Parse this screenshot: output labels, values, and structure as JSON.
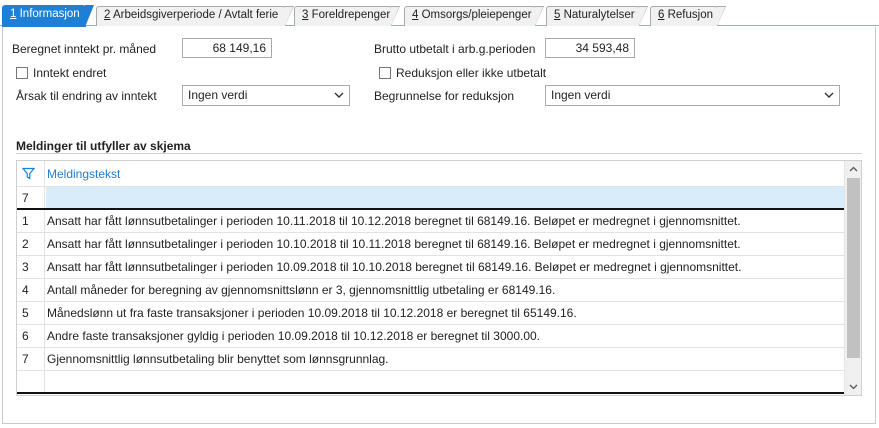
{
  "tabs": [
    {
      "key": "1",
      "label": " Informasjon",
      "active": true
    },
    {
      "key": "2",
      "label": " Arbeidsgiverperiode / Avtalt ferie",
      "active": false
    },
    {
      "key": "3",
      "label": " Foreldrepenger",
      "active": false
    },
    {
      "key": "4",
      "label": " Omsorgs/pleiepenger",
      "active": false
    },
    {
      "key": "5",
      "label": " Naturalytelser",
      "active": false
    },
    {
      "key": "6",
      "label": " Refusjon",
      "active": false
    }
  ],
  "form": {
    "income_label": "Beregnet inntekt pr. måned",
    "income_value": "68 149,16",
    "gross_label": "Brutto utbetalt i arb.g.perioden",
    "gross_value": "34 593,48",
    "income_changed_label": "Inntekt endret",
    "reduction_label": "Reduksjon eller ikke utbetalt",
    "reason_label": "Årsak til endring av inntekt",
    "reason_value": "Ingen verdi",
    "justification_label": "Begrunnelse for reduksjon",
    "justification_value": "Ingen verdi"
  },
  "messages": {
    "title": "Meldinger til utfyller av skjema",
    "column_header": "Meldingstekst",
    "filter_value": "7",
    "rows": [
      {
        "idx": "1",
        "text": "Ansatt har fått lønnsutbetalinger i perioden 10.11.2018 til 10.12.2018 beregnet til 68149.16. Beløpet er medregnet i gjennomsnittet."
      },
      {
        "idx": "2",
        "text": "Ansatt har fått lønnsutbetalinger i perioden 10.10.2018 til 10.11.2018 beregnet til 68149.16. Beløpet er medregnet i gjennomsnittet."
      },
      {
        "idx": "3",
        "text": "Ansatt har fått lønnsutbetalinger i perioden 10.09.2018 til 10.10.2018 beregnet til 68149.16. Beløpet er medregnet i gjennomsnittet."
      },
      {
        "idx": "4",
        "text": "Antall måneder for beregning av gjennomsnittslønn er 3, gjennomsnittlig utbetaling er 68149.16."
      },
      {
        "idx": "5",
        "text": "Månedslønn ut fra faste transaksjoner i perioden 10.09.2018 til 10.12.2018 er beregnet til 65149.16."
      },
      {
        "idx": "6",
        "text": "Andre faste transaksjoner gyldig i perioden 10.09.2018 til 10.12.2018 er beregnet til 3000.00."
      },
      {
        "idx": "7",
        "text": "Gjennomsnittlig lønnsutbetaling blir benyttet som lønnsgrunnlag."
      }
    ]
  },
  "colors": {
    "accent": "#1e7fd4",
    "filter_row": "#d9ecfa"
  },
  "icons": [
    "filter-icon",
    "chevron-down-icon",
    "scroll-up-icon",
    "scroll-down-icon"
  ]
}
